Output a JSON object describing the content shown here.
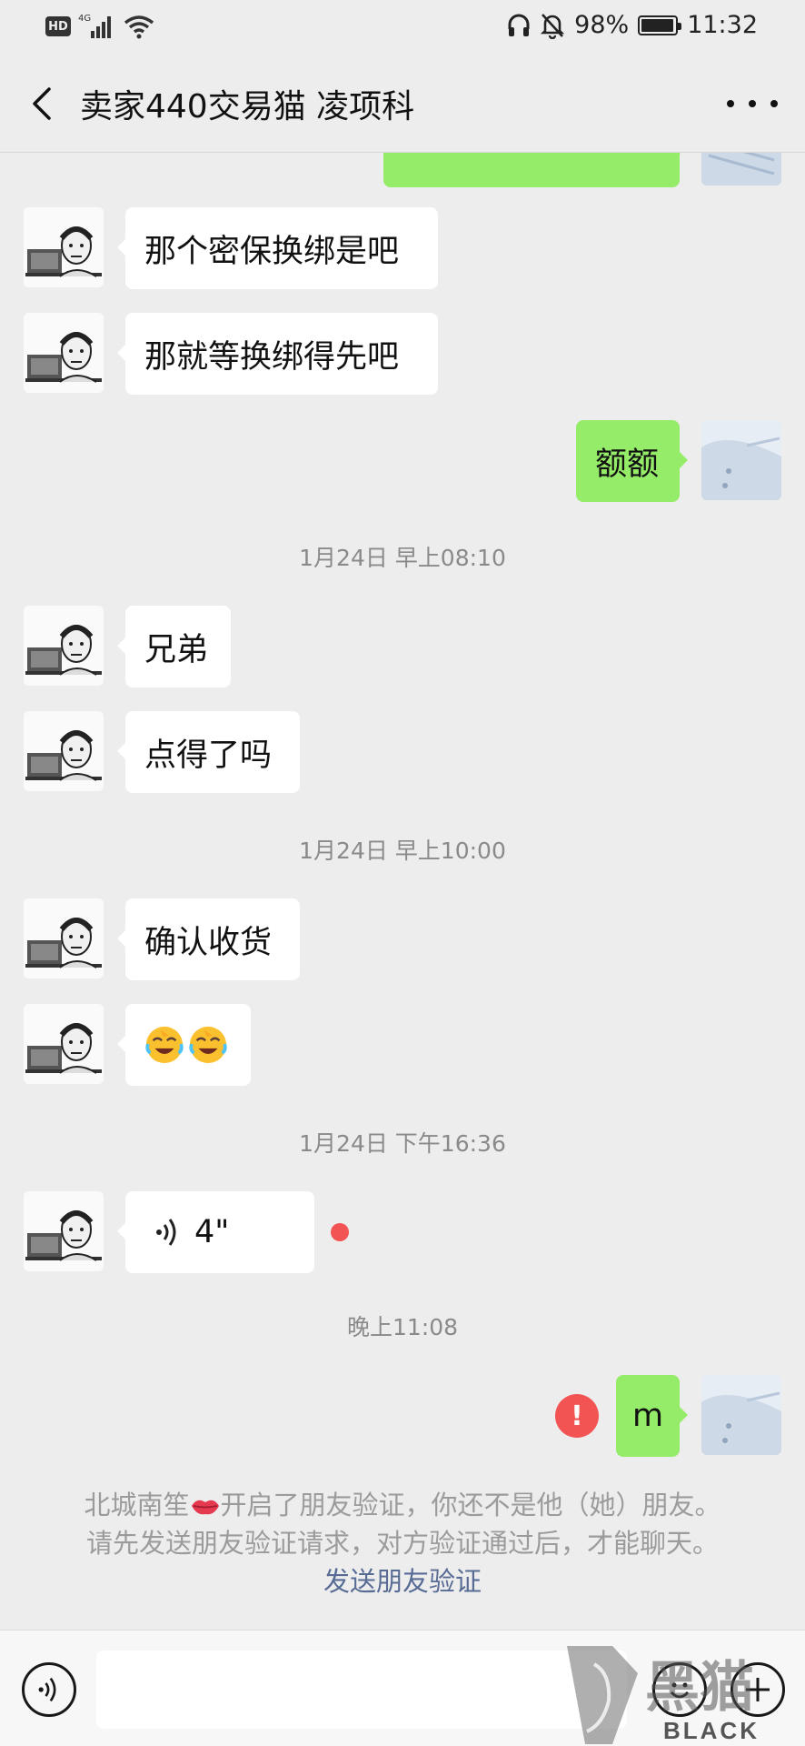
{
  "status_bar": {
    "hd_badge": "HD",
    "network": "4G",
    "battery_percent": "98%",
    "battery_level": 0.98,
    "time": "11:32"
  },
  "header": {
    "title": "卖家440交易猫 凌项科",
    "back_icon": "chevron-left-icon",
    "more_icon": "ellipsis-icon"
  },
  "messages": {
    "m1": "那个密保换绑是吧",
    "m2": "那就等换绑得先吧",
    "m3": "额额",
    "ts1": "1月24日 早上08:10",
    "m4": "兄弟",
    "m5": "点得了吗",
    "ts2": "1月24日 早上10:00",
    "m6": "确认收货",
    "m7_emoji": "crying-laughing-emoji x2",
    "ts3": "1月24日 下午16:36",
    "voice_duration": "4\"",
    "ts4": "晚上11:08",
    "m8": "m",
    "fail_mark": "!"
  },
  "system_notice": {
    "part1": "北城南笙",
    "part2": "开启了朋友验证，你还不是他（她）朋友。",
    "part3": "请先发送朋友验证请求，对方验证通过后，才能聊天。",
    "link": "发送朋友验证"
  },
  "input_bar": {
    "voice_icon": "voice-input-icon",
    "emoji_icon": "emoji-face-icon",
    "plus_icon": "plus-icon"
  },
  "watermark": {
    "brand": "BLACK CAT",
    "brand_cn": "黑猫"
  },
  "colors": {
    "background": "#ededed",
    "outgoing_bubble": "#95ec69",
    "incoming_bubble": "#ffffff",
    "link": "#576b95",
    "alert": "#f25353"
  }
}
